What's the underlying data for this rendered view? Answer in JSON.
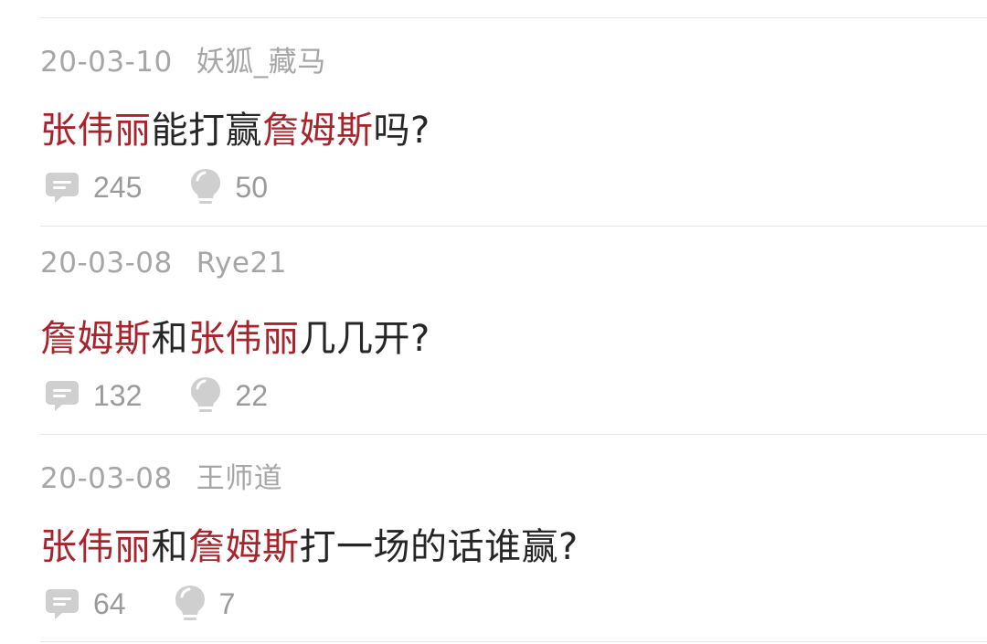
{
  "colors": {
    "highlight": "#a8242c",
    "title_text": "#262626",
    "meta_text": "#a6a6a6",
    "icon": "#cfcfcf",
    "divider": "#e6e6e6"
  },
  "posts": [
    {
      "date": "20-03-10",
      "author": "妖狐_藏马",
      "title_parts": [
        "张伟丽",
        "能打赢",
        "詹姆斯",
        "吗?"
      ],
      "comments": "245",
      "likes": "50",
      "comment_icon": "comment-bubble-icon",
      "like_icon": "lightbulb-icon"
    },
    {
      "date": "20-03-08",
      "author": "Rye21",
      "title_parts": [
        "詹姆斯",
        "和",
        "张伟丽",
        "几几开?"
      ],
      "comments": "132",
      "likes": "22",
      "comment_icon": "comment-bubble-icon",
      "like_icon": "lightbulb-icon"
    },
    {
      "date": "20-03-08",
      "author": "王师道",
      "title_parts": [
        "张伟丽",
        "和",
        "詹姆斯",
        "打一场的话谁赢?"
      ],
      "comments": "64",
      "likes": "7",
      "comment_icon": "comment-bubble-icon",
      "like_icon": "lightbulb-icon"
    }
  ]
}
